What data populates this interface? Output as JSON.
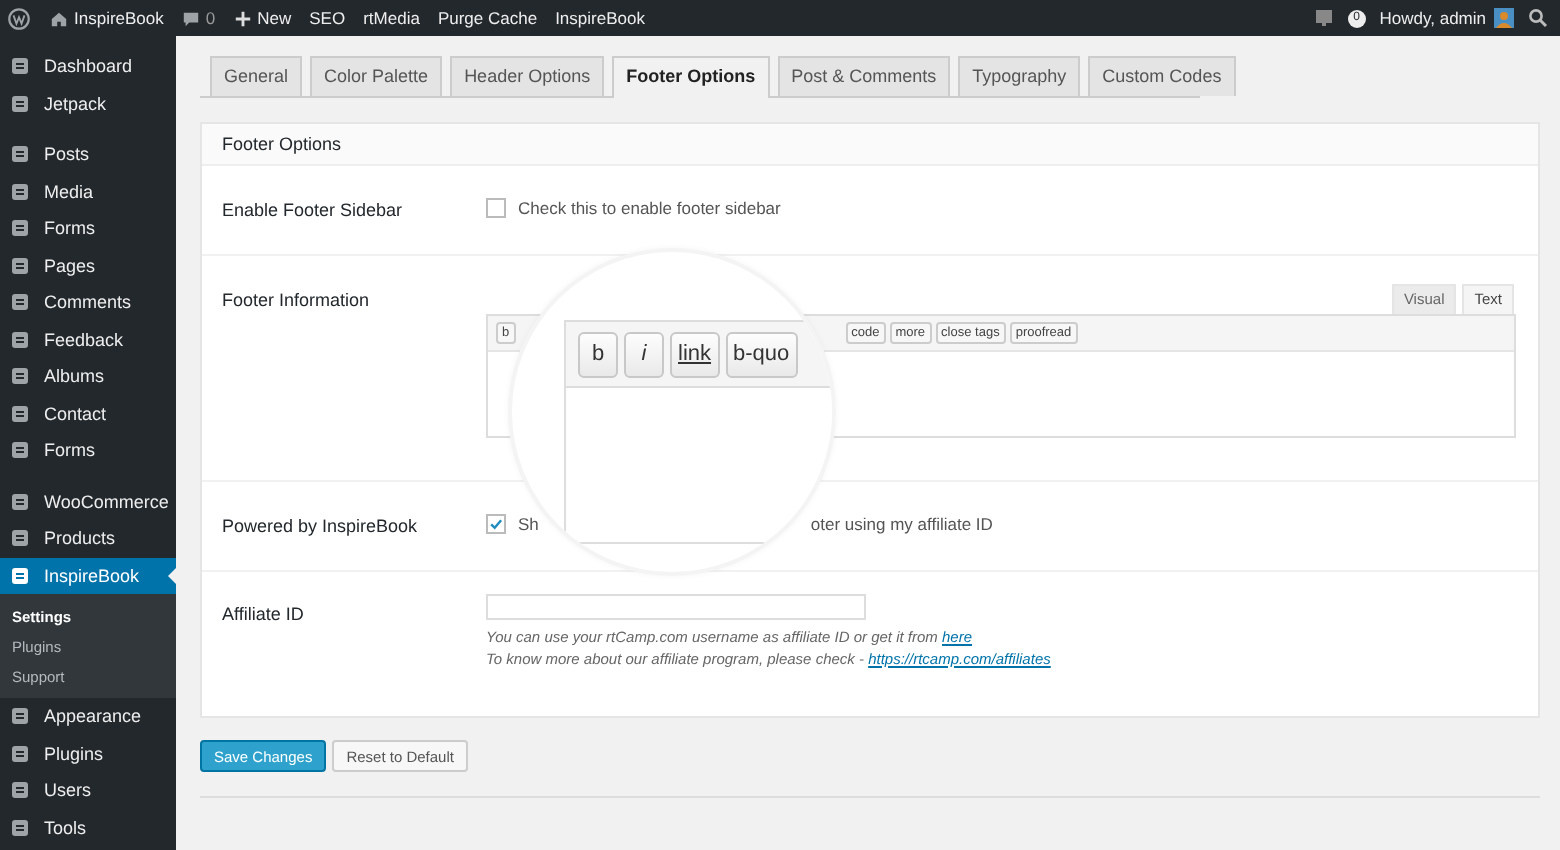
{
  "admin_bar": {
    "site": "InspireBook",
    "comments": "0",
    "new_label": "New",
    "links": [
      "SEO",
      "rtMedia",
      "Purge Cache",
      "InspireBook"
    ],
    "notifications": "0",
    "greeting": "Howdy, admin"
  },
  "sidebar": {
    "groups": [
      [
        {
          "label": "Dashboard",
          "selected": false
        },
        {
          "label": "Jetpack",
          "selected": false
        }
      ],
      [
        {
          "label": "Posts",
          "selected": false
        },
        {
          "label": "Media",
          "selected": false
        },
        {
          "label": "Forms",
          "selected": false
        },
        {
          "label": "Pages",
          "selected": false
        },
        {
          "label": "Comments",
          "selected": false
        },
        {
          "label": "Feedback",
          "selected": false
        },
        {
          "label": "Albums",
          "selected": false
        },
        {
          "label": "Contact",
          "selected": false
        },
        {
          "label": "Forms",
          "selected": false
        }
      ],
      [
        {
          "label": "WooCommerce",
          "selected": false
        },
        {
          "label": "Products",
          "selected": false
        },
        {
          "label": "InspireBook",
          "selected": true,
          "children": [
            {
              "label": "Settings",
              "selected": true
            },
            {
              "label": "Plugins",
              "selected": false
            },
            {
              "label": "Support",
              "selected": false
            }
          ]
        },
        {
          "label": "Appearance",
          "selected": false
        },
        {
          "label": "Plugins",
          "selected": false
        },
        {
          "label": "Users",
          "selected": false
        },
        {
          "label": "Tools",
          "selected": false
        }
      ]
    ]
  },
  "tabs": [
    {
      "label": "General",
      "selected": false
    },
    {
      "label": "Color Palette",
      "selected": false
    },
    {
      "label": "Header Options",
      "selected": false
    },
    {
      "label": "Footer Options",
      "selected": true
    },
    {
      "label": "Post & Comments",
      "selected": false
    },
    {
      "label": "Typography",
      "selected": false
    },
    {
      "label": "Custom Codes",
      "selected": false
    }
  ],
  "panel": {
    "title": "Footer Options",
    "rows": [
      {
        "kind": "checkbox",
        "label": "Enable Footer Sidebar",
        "checked": false,
        "text_parts": [
          "Check this to enable footer sidebar"
        ]
      },
      {
        "kind": "editor",
        "label": "Footer Information",
        "modes": [
          {
            "label": "Visual",
            "selected": false
          },
          {
            "label": "Text",
            "selected": true
          }
        ],
        "toolbar_left": [
          "b"
        ],
        "toolbar_right": [
          "code",
          "more",
          "close tags",
          "proofread"
        ]
      },
      {
        "kind": "checkbox",
        "label": "Powered by InspireBook",
        "checked": true,
        "text_parts": [
          "Sh",
          "oter using my affiliate ID"
        ]
      },
      {
        "kind": "input",
        "label": "Affiliate ID",
        "help": [
          {
            "text": "You can use your rtCamp.com username as affiliate ID or get it from",
            "link": "here"
          },
          {
            "text": "To know more about our affiliate program, please check -",
            "link": "https://rtcamp.com/affiliates"
          }
        ]
      }
    ]
  },
  "magnifier": {
    "buttons": [
      {
        "label": "b",
        "kind": "plain"
      },
      {
        "label": "i",
        "kind": "italic"
      },
      {
        "label": "link",
        "kind": "link"
      },
      {
        "label": "b-quo",
        "kind": "plain"
      }
    ]
  },
  "buttons": [
    {
      "label": "Save Changes",
      "kind": "primary"
    },
    {
      "label": "Reset to Default",
      "kind": "secondary"
    }
  ]
}
